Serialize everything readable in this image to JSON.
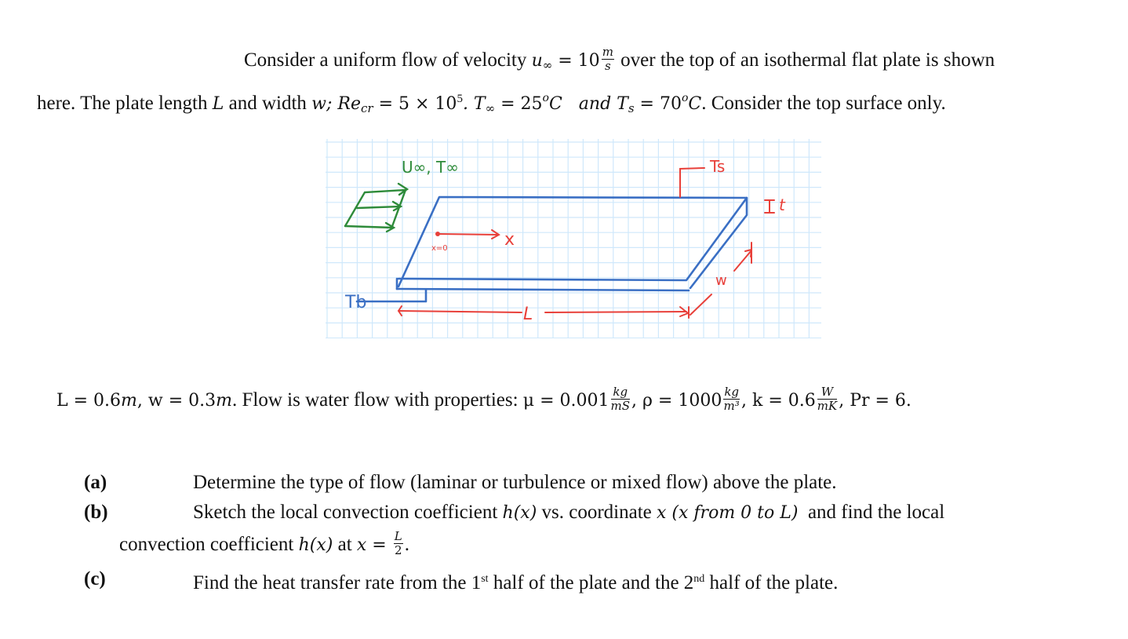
{
  "intro": {
    "line1_prefix": "Consider a uniform flow of velocity ",
    "u_symbol": "u",
    "u_sub": "∞",
    "u_eq": " = 10",
    "u_unit_num": "m",
    "u_unit_den": "s",
    "line1_suffix": " over the top of an isothermal flat plate is shown",
    "line2_prefix": "here. The plate length ",
    "L_symbol": "L",
    "line2_mid1": " and width ",
    "w_symbol": "w; ",
    "re_symbol": "Re",
    "re_sub": "cr",
    "re_eq": " = 5 × 10",
    "re_exp": "5",
    "t_inf_lead": ". T",
    "t_inf_sub": "∞",
    "t_inf_eq": " = 25",
    "deg": "o",
    "celsius": "C",
    "and_text": "   and T",
    "ts_sub": "s",
    "ts_eq": " = 70",
    "celsius2": "C",
    "line2_suffix": ". Consider the top surface only."
  },
  "figure": {
    "flow_label": "U∞, T∞",
    "surface_temp_label": "Ts",
    "thickness_label": "t",
    "x_axis_label": "x",
    "x_origin_label": "x=0",
    "base_temp_label": "Tb",
    "length_label": "L",
    "width_label": "w",
    "colors": {
      "grid": "#cfe8fb",
      "plate": "#3a6fc4",
      "annotation": "#e8403a",
      "flow": "#2e8b3a"
    }
  },
  "properties": {
    "L_part": "L = 0.6",
    "L_unit": "m",
    "w_part": ", w = 0.3",
    "w_unit": "m",
    "text": ". Flow is water flow with properties: ",
    "mu_part": "μ = 0.001",
    "mu_num": "kg",
    "mu_den": "mS",
    "rho_part": ", ρ = 1000",
    "rho_num": "kg",
    "rho_den": "m³",
    "k_part": ", k = 0.6",
    "k_num": "W",
    "k_den": "mK",
    "pr_part": ", Pr = 6."
  },
  "questions": [
    {
      "label": "(a)",
      "text": "Determine the type of flow (laminar or turbulence or mixed flow) above the plate."
    },
    {
      "label": "(b)",
      "text_prefix": "Sketch the local convection coefficient ",
      "hx": "h(x)",
      "text_mid": " vs. coordinate ",
      "x_sym": "x",
      "range": " (x from 0 to L)",
      "text_suffix": "  and find the local",
      "cont_prefix": "convection coefficient ",
      "cont_hx": "h(x)",
      "cont_mid": " at ",
      "cont_x": "x = ",
      "cont_num": "L",
      "cont_den": "2",
      "cont_end": "."
    },
    {
      "label": "(c)",
      "text_prefix": "Find the heat transfer rate from the 1",
      "sup1": "st",
      "text_mid": " half of the plate and the 2",
      "sup2": "nd",
      "text_suffix": " half of the plate."
    }
  ]
}
